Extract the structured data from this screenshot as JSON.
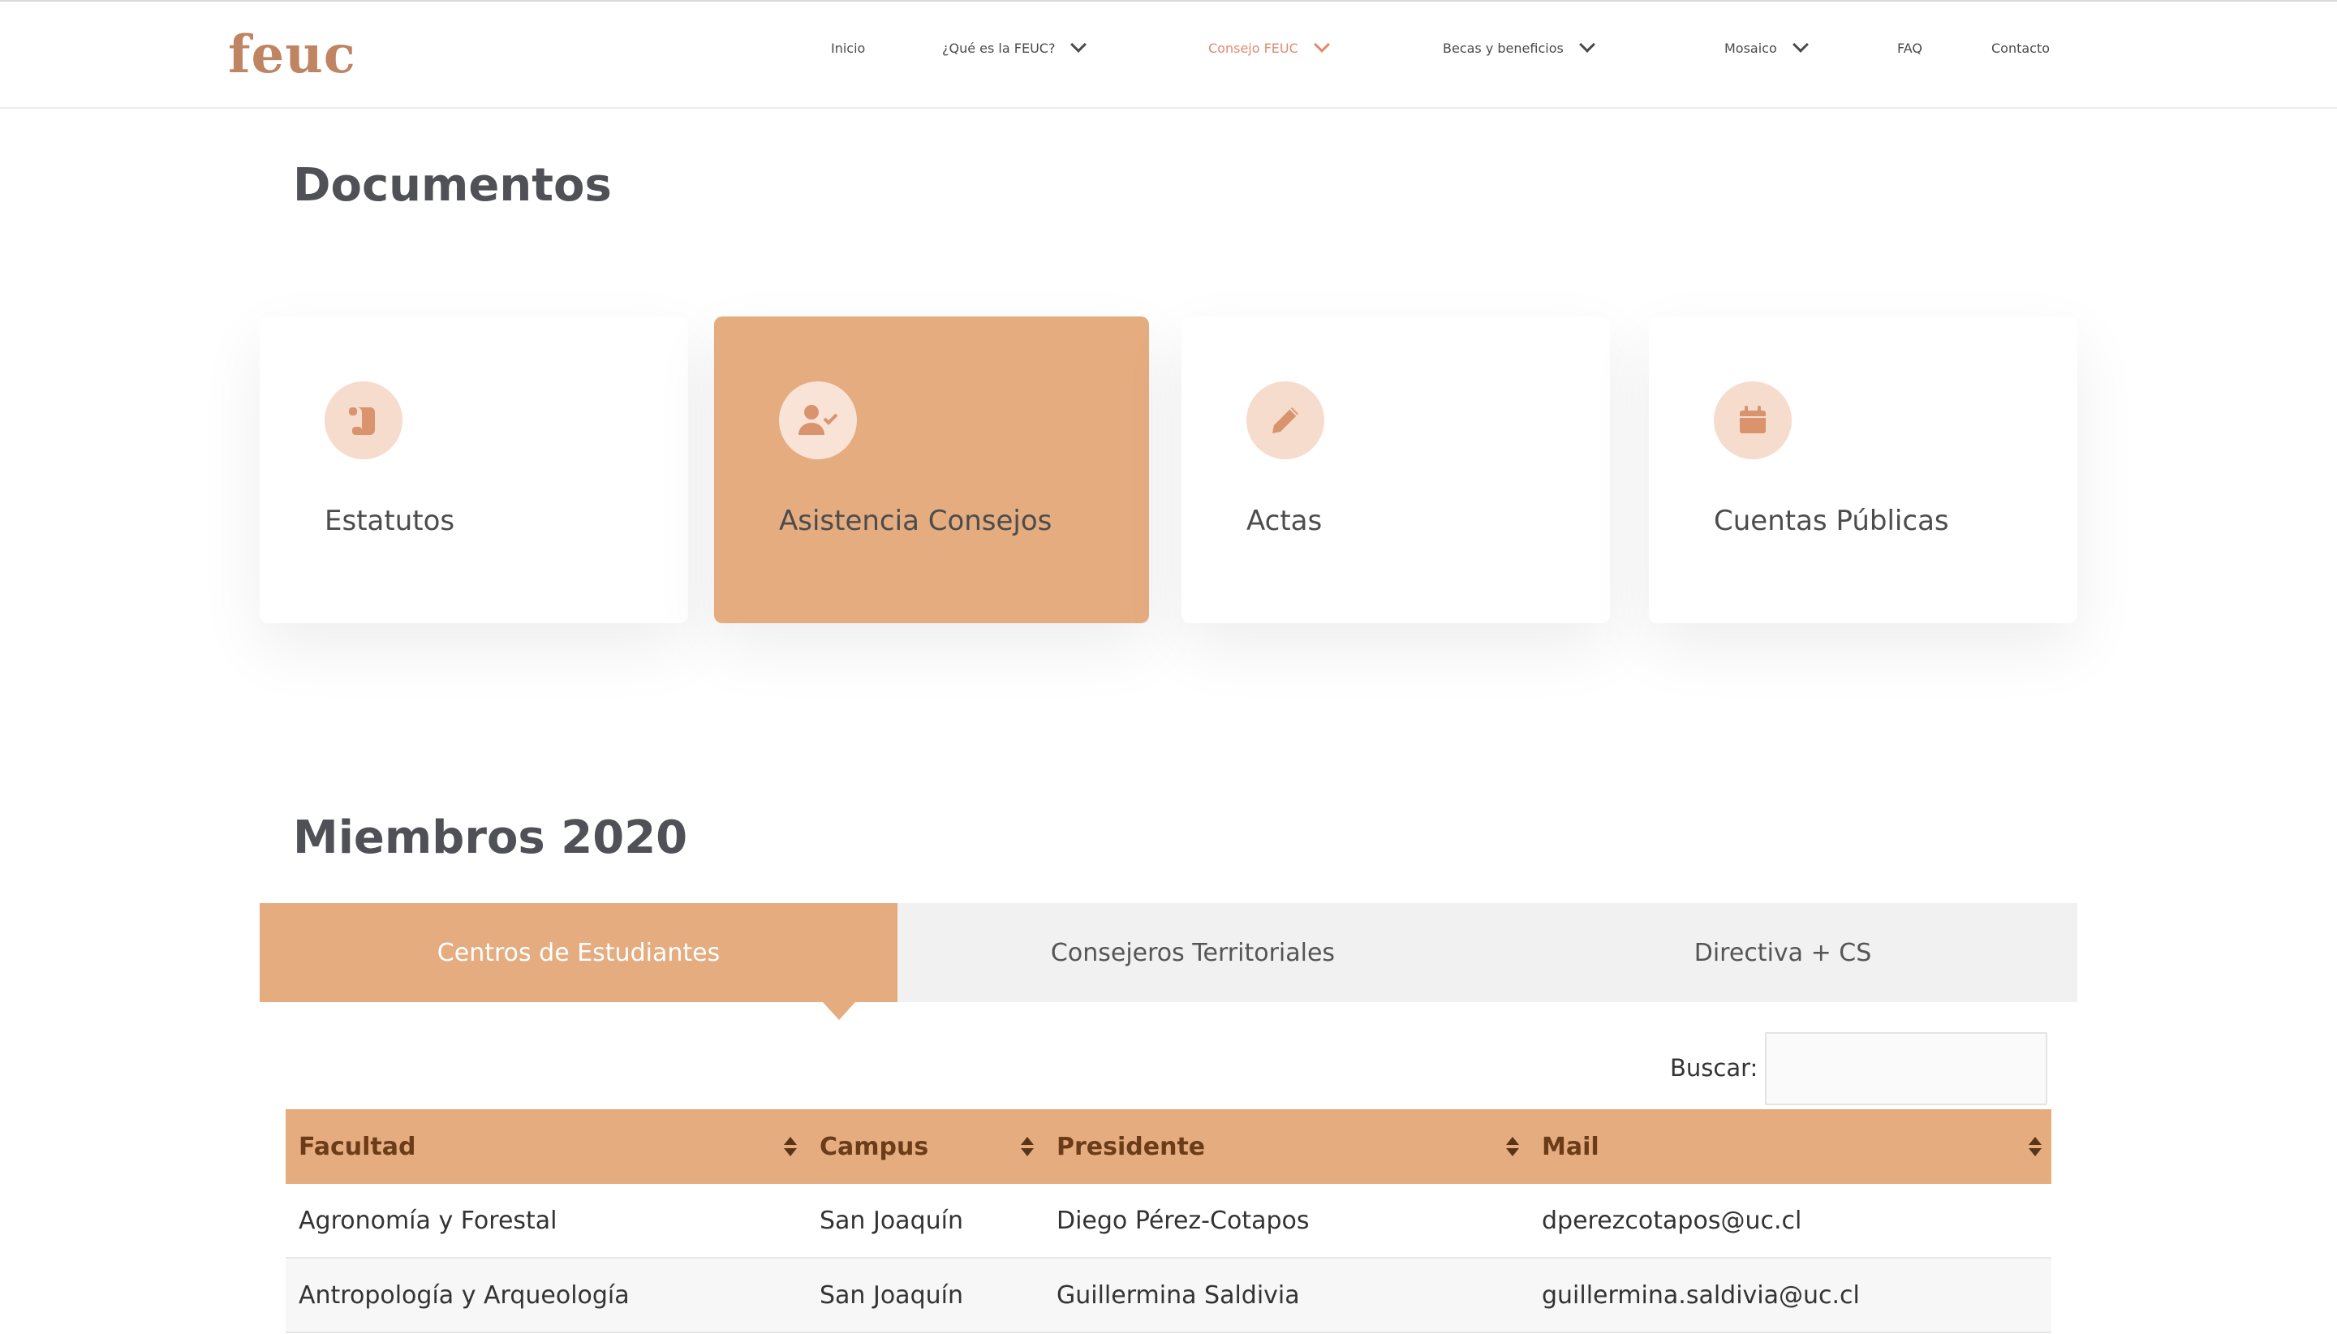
{
  "header": {
    "logo": "feuc",
    "nav": [
      {
        "label": "Inicio",
        "dropdown": false,
        "active": false
      },
      {
        "label": "¿Qué es la FEUC?",
        "dropdown": true,
        "active": false
      },
      {
        "label": "Consejo FEUC",
        "dropdown": true,
        "active": true
      },
      {
        "label": "Becas y beneficios",
        "dropdown": true,
        "active": false
      },
      {
        "label": "Mosaico",
        "dropdown": true,
        "active": false
      },
      {
        "label": "FAQ",
        "dropdown": false,
        "active": false
      },
      {
        "label": "Contacto",
        "dropdown": false,
        "active": false
      }
    ]
  },
  "documents": {
    "title": "Documentos",
    "cards": [
      {
        "label": "Estatutos",
        "icon": "scroll-icon",
        "active": false
      },
      {
        "label": "Asistencia Consejos",
        "icon": "user-check-icon",
        "active": true
      },
      {
        "label": "Actas",
        "icon": "pencil-icon",
        "active": false
      },
      {
        "label": "Cuentas Públicas",
        "icon": "calendar-icon",
        "active": false
      }
    ]
  },
  "members": {
    "title": "Miembros 2020",
    "tabs": [
      {
        "label": "Centros de Estudiantes",
        "active": true
      },
      {
        "label": "Consejeros Territoriales",
        "active": false
      },
      {
        "label": "Directiva + CS",
        "active": false
      }
    ],
    "search": {
      "label": "Buscar:",
      "value": ""
    },
    "table": {
      "columns": [
        "Facultad",
        "Campus",
        "Presidente",
        "Mail"
      ],
      "rows": [
        [
          "Agronomía y Forestal",
          "San Joaquín",
          "Diego Pérez-Cotapos",
          "dperezcotapos@uc.cl"
        ],
        [
          "Antropología y Arqueología",
          "San Joaquín",
          "Guillermina Saldivia",
          "guillermina.saldivia@uc.cl"
        ]
      ]
    }
  },
  "colors": {
    "accent": "#e5ac80",
    "nav_active": "#e08a6e",
    "logo": "#bf8563",
    "icon": "#d9936d"
  }
}
